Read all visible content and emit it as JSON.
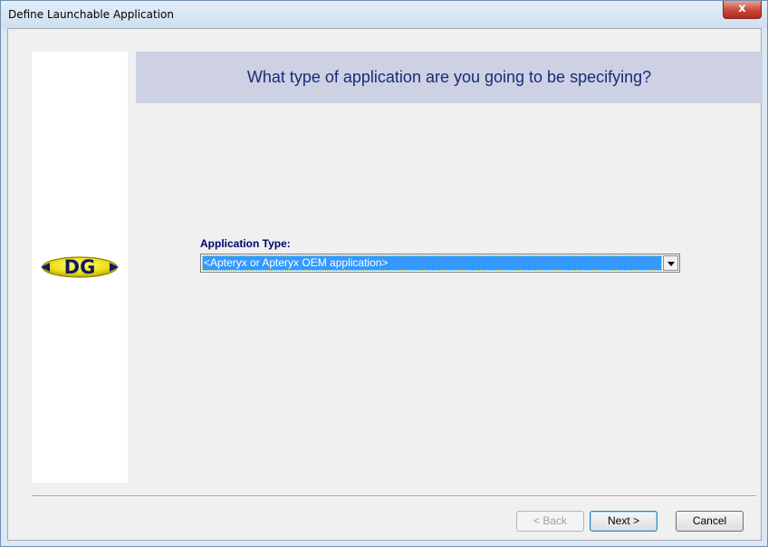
{
  "window": {
    "title": "Define Launchable Application",
    "close_glyph": "x"
  },
  "header": {
    "question": "What type of application are you going to be specifying?"
  },
  "logo": {
    "text": "DG",
    "icon": "dg-logo-icon"
  },
  "form": {
    "application_type_label": "Application Type:",
    "application_type_value": "<Apteryx or Apteryx OEM application>"
  },
  "buttons": {
    "back_label": "< Back",
    "next_label": "Next >",
    "cancel_label": "Cancel"
  },
  "colors": {
    "header_band": "#cdd1e3",
    "selection": "#3399ff",
    "label_text": "#000070"
  }
}
